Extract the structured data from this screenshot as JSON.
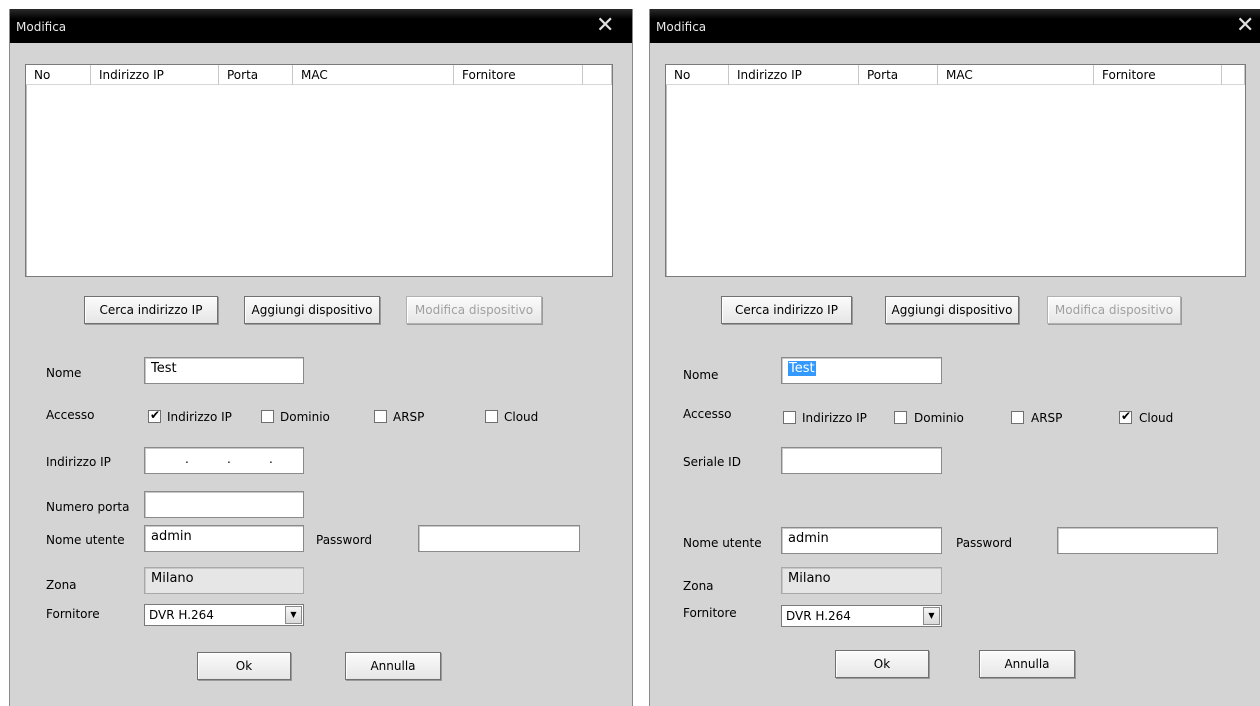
{
  "left": {
    "title": "Modifica",
    "close_icon": "close-icon",
    "columns": [
      "No",
      "Indirizzo IP",
      "Porta",
      "MAC",
      "Fornitore"
    ],
    "buttons": {
      "search": "Cerca indirizzo IP",
      "add": "Aggiungi dispositivo",
      "edit": "Modifica dispositivo"
    },
    "labels": {
      "name": "Nome",
      "access": "Accesso",
      "ip": "Indirizzo IP",
      "port": "Numero porta",
      "username": "Nome utente",
      "password": "Password",
      "zone": "Zona",
      "vendor": "Fornitore"
    },
    "access_options": {
      "ip": "Indirizzo IP",
      "domain": "Dominio",
      "arsp": "ARSP",
      "cloud": "Cloud"
    },
    "access_checked": "Indirizzo IP",
    "values": {
      "name": "Test",
      "ip": "",
      "port": "",
      "username": "admin",
      "password": "",
      "zone": "Milano",
      "vendor": "DVR H.264"
    },
    "ok": "Ok",
    "cancel": "Annulla"
  },
  "right": {
    "title": "Modifica",
    "close_icon": "close-icon",
    "columns": [
      "No",
      "Indirizzo IP",
      "Porta",
      "MAC",
      "Fornitore"
    ],
    "buttons": {
      "search": "Cerca indirizzo IP",
      "add": "Aggiungi dispositivo",
      "edit": "Modifica dispositivo"
    },
    "labels": {
      "name": "Nome",
      "access": "Accesso",
      "serial": "Seriale ID",
      "username": "Nome utente",
      "password": "Password",
      "zone": "Zona",
      "vendor": "Fornitore"
    },
    "access_options": {
      "ip": "Indirizzo IP",
      "domain": "Dominio",
      "arsp": "ARSP",
      "cloud": "Cloud"
    },
    "access_checked": "Cloud",
    "values": {
      "name": "Test",
      "serial": "",
      "username": "admin",
      "password": "",
      "zone": "Milano",
      "vendor": "DVR H.264"
    },
    "ok": "Ok",
    "cancel": "Annulla"
  }
}
